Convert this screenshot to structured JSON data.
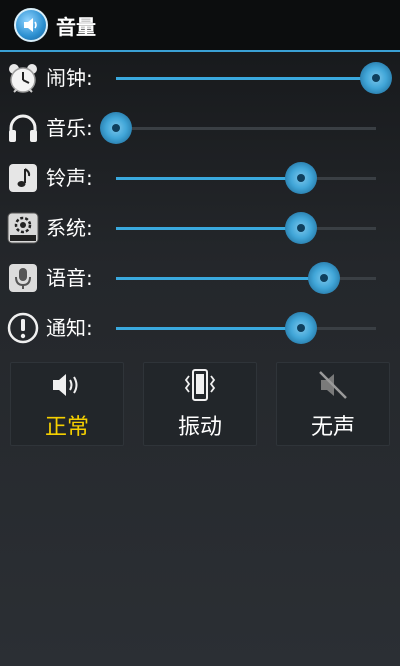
{
  "header": {
    "title": "音量"
  },
  "rows": [
    {
      "label": "闹钟:",
      "icon": "alarm-clock-icon",
      "level": 1.0
    },
    {
      "label": "音乐:",
      "icon": "headphones-icon",
      "level": 0.0
    },
    {
      "label": "铃声:",
      "icon": "music-note-icon",
      "level": 0.71
    },
    {
      "label": "系统:",
      "icon": "system-gear-icon",
      "level": 0.71
    },
    {
      "label": "语音:",
      "icon": "microphone-icon",
      "level": 0.8
    },
    {
      "label": "通知:",
      "icon": "notification-icon",
      "level": 0.71
    }
  ],
  "modes": [
    {
      "label": "正常",
      "icon": "speaker-icon",
      "active": true
    },
    {
      "label": "振动",
      "icon": "vibrate-phone-icon",
      "active": false
    },
    {
      "label": "无声",
      "icon": "mute-icon",
      "active": false
    }
  ],
  "colors": {
    "accent": "#3aa9de",
    "active_mode": "#f5d000",
    "background": "#24272b"
  }
}
